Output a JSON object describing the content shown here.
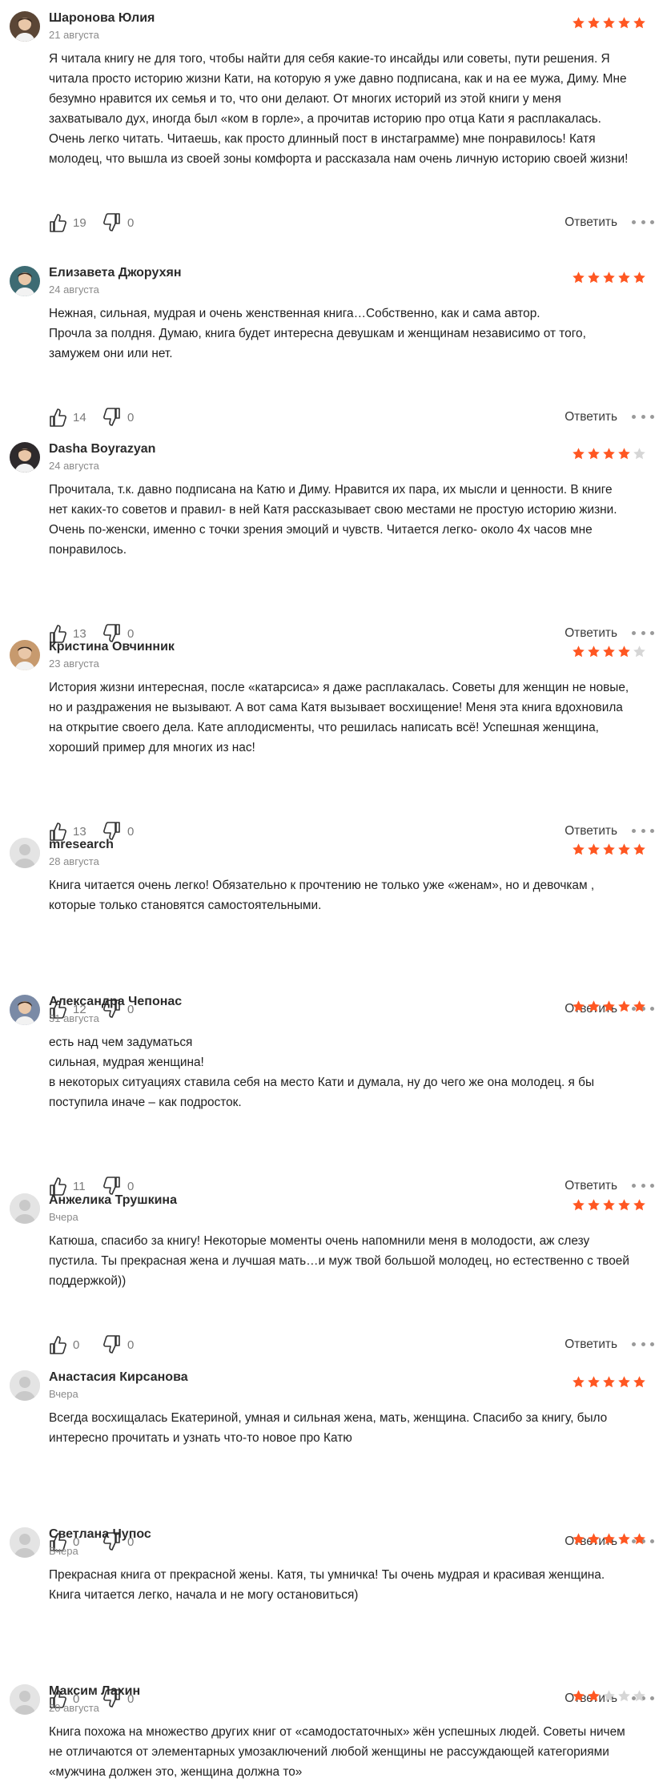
{
  "ui": {
    "reply_label": "Ответить",
    "star_color_on": "#ff5722",
    "star_color_off": "#d6d6d6"
  },
  "reviews": [
    {
      "author": "Шаронова Юлия",
      "date": "21 августа",
      "rating": 5,
      "avatar": "photo",
      "likes": "19",
      "dislikes": "0",
      "lines": [
        "Я читала книгу не для того, чтобы найти для себя какие-то инсайды или советы, пути решения. Я",
        "читала просто историю жизни Кати, на которую я уже давно подписана, как и на ее мужа, Диму. Мне",
        "безумно нравится их семья и то, что они делают. От многих историй из этой книги у меня",
        "захватывало дух, иногда был «ком в горле», а прочитав историю про отца Кати я расплакалась.",
        "Очень легко читать. Читаешь, как просто длинный пост в инстаграмме) мне понравилось! Катя",
        "молодец, что вышла из своей зоны комфорта и рассказала нам очень личную историю своей жизни!"
      ]
    },
    {
      "author": "Елизавета Джорухян",
      "date": "24 августа",
      "rating": 5,
      "avatar": "photo",
      "likes": "14",
      "dislikes": "0",
      "lines": [
        "Нежная, сильная, мудрая и очень женственная книга…Собственно, как и сама автор.",
        "Прочла за полдня. Думаю, книга будет интересна девушкам и женщинам независимо от того,",
        "замужем они или нет."
      ]
    },
    {
      "author": "Dasha Boyrazyan",
      "date": "24 августа",
      "rating": 4,
      "avatar": "photo",
      "likes": "13",
      "dislikes": "0",
      "lines": [
        "Прочитала, т.к. давно подписана на Катю и Диму. Нравится их пара, их мысли и ценности. В книге",
        "нет каких-то советов и правил- в ней Катя рассказывает свою местами не простую историю жизни.",
        "Очень по-женски, именно с точки зрения эмоций и чувств. Читается легко- около 4х часов мне",
        "понравилось."
      ]
    },
    {
      "author": "Кристина Овчинник",
      "date": "23 августа",
      "rating": 4,
      "avatar": "photo",
      "likes": "13",
      "dislikes": "0",
      "lines": [
        "История жизни интересная, после «катарсиса» я даже расплакалась. Советы для женщин не новые,",
        "но и раздражения не вызывают. А вот сама Катя вызывает восхищение! Меня эта книга вдохновила",
        "на открытие своего дела. Кате аплодисменты, что решилась написать всё! Успешная женщина,",
        "хороший пример для многих из нас!"
      ]
    },
    {
      "author": "mresearch",
      "date": "28 августа",
      "rating": 5,
      "avatar": "default",
      "likes": "12",
      "dislikes": "0",
      "lines": [
        "Книга читается очень легко! Обязательно к прочтению не только уже «женам», но и девочкам ,",
        "которые только становятся самостоятельными."
      ]
    },
    {
      "author": "Александра Чепонас",
      "date": "31 августа",
      "rating": 5,
      "avatar": "photo",
      "likes": "11",
      "dislikes": "0",
      "lines": [
        "есть над чем задуматься",
        "сильная, мудрая женщина!",
        "в некоторых ситуациях ставила себя на место Кати и думала, ну до чего же она молодец. я бы",
        "поступила иначе – как подросток."
      ]
    },
    {
      "author": "Анжелика Трушкина",
      "date": "Вчера",
      "rating": 5,
      "avatar": "default",
      "likes": "0",
      "dislikes": "0",
      "lines": [
        "Катюша, спасибо за книгу! Некоторые моменты очень напомнили меня в молодости, аж слезу",
        "пустила. Ты прекрасная жена и лучшая мать…и муж твой большой молодец, но естественно с твоей",
        "поддержкой))"
      ]
    },
    {
      "author": "Анастасия Кирсанова",
      "date": "Вчера",
      "rating": 5,
      "avatar": "default",
      "likes": "0",
      "dislikes": "0",
      "lines": [
        "Всегда восхищалась Екатериной, умная и сильная жена, мать, женщина. Спасибо за книгу, было",
        "интересно прочитать и узнать что-то новое про Катю"
      ]
    },
    {
      "author": "Светлана Чупос",
      "date": "Вчера",
      "rating": 5,
      "avatar": "default",
      "likes": "0",
      "dislikes": "0",
      "lines": [
        "Прекрасная книга от прекрасной жены. Катя, ты умничка! Ты очень мудрая и красивая женщина.",
        "Книга читается легко, начала и не могу остановиться)"
      ]
    },
    {
      "author": "Максим Лахин",
      "date": "20 августа",
      "rating": 2,
      "avatar": "default",
      "likes": "",
      "dislikes": "",
      "lines": [
        "Книга похожа на множество других книг от «самодостаточных» жён успешных людей. Советы ничем",
        "не отличаются от элементарных умозаключений любой женщины не рассуждающей категориями",
        "«мужчина должен это, женщина должна то»"
      ]
    }
  ]
}
